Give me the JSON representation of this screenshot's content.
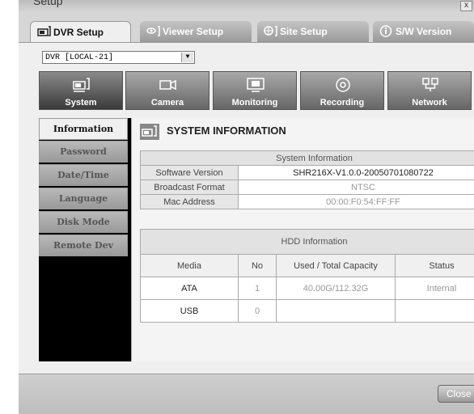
{
  "window": {
    "title": "Setup",
    "close_glyph": "x"
  },
  "tabs": [
    {
      "label": "DVR Setup",
      "icon": "dvr-setup-icon"
    },
    {
      "label": "Viewer Setup",
      "icon": "viewer-setup-icon"
    },
    {
      "label": "Site Setup",
      "icon": "site-setup-icon"
    },
    {
      "label": "S/W Version",
      "icon": "info-icon"
    }
  ],
  "dvr_select": {
    "value": "DVR [LOCAL-21]",
    "arrow": "▼"
  },
  "categories": [
    {
      "label": "System",
      "icon": "system-icon"
    },
    {
      "label": "Camera",
      "icon": "camera-icon"
    },
    {
      "label": "Monitoring",
      "icon": "monitor-icon"
    },
    {
      "label": "Recording",
      "icon": "recording-icon"
    },
    {
      "label": "Network",
      "icon": "network-icon"
    }
  ],
  "sidebar": [
    {
      "label": "Information"
    },
    {
      "label": "Password"
    },
    {
      "label": "Date/Time"
    },
    {
      "label": "Language"
    },
    {
      "label": "Disk Mode"
    },
    {
      "label": "Remote Dev"
    }
  ],
  "content": {
    "title": "SYSTEM INFORMATION",
    "system_info": {
      "header": "System Information",
      "rows": [
        {
          "label": "Software Version",
          "value": "SHR216X-V1.0.0-20050701080722"
        },
        {
          "label": "Broadcast Format",
          "value": "NTSC"
        },
        {
          "label": "Mac Address",
          "value": "00:00:F0:54:FF:FF"
        }
      ]
    },
    "hdd_info": {
      "header": "HDD Information",
      "columns": [
        "Media",
        "No",
        "Used / Total Capacity",
        "Status"
      ],
      "rows": [
        [
          "ATA",
          "1",
          "40.00G/112.32G",
          "Internal"
        ],
        [
          "USB",
          "0",
          "",
          ""
        ]
      ]
    }
  },
  "footer": {
    "close_label": "Close"
  }
}
